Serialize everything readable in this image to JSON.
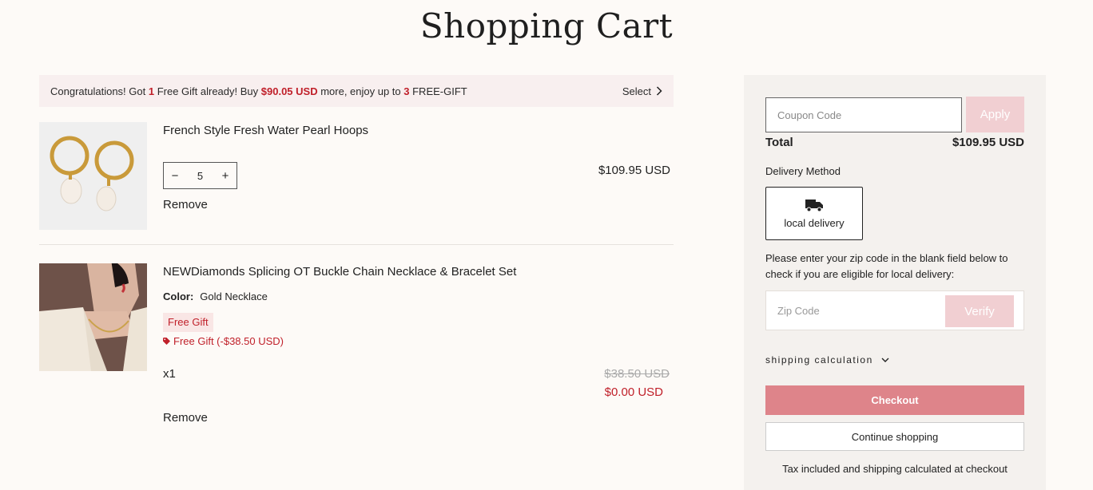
{
  "page": {
    "title": "Shopping Cart"
  },
  "banner": {
    "text1": "Congratulations! Got ",
    "gift_count": "1",
    "text2": " Free Gift already! Buy ",
    "amount": "$90.05 USD",
    "text3": " more, enjoy up to ",
    "max_gifts": "3",
    "text4": " FREE-GIFT",
    "select_label": "Select"
  },
  "items": [
    {
      "name": "French Style Fresh Water Pearl Hoops",
      "quantity": "5",
      "price": "$109.95 USD",
      "remove_label": "Remove"
    },
    {
      "name": "NEWDiamonds Splicing OT Buckle Chain Necklace & Bracelet Set",
      "option_label": "Color:",
      "option_value": "Gold Necklace",
      "badge": "Free Gift",
      "discount": "Free Gift (-$38.50 USD)",
      "quantity_text": "x1",
      "original_price": "$38.50 USD",
      "price": "$0.00 USD",
      "remove_label": "Remove"
    }
  ],
  "summary": {
    "coupon_placeholder": "Coupon Code",
    "apply_label": "Apply",
    "total_label": "Total",
    "total_value": "$109.95 USD",
    "delivery_label": "Delivery Method",
    "delivery_option": "local delivery",
    "zip_instructions": "Please enter your zip code in the blank field below to check if you are eligible for local delivery:",
    "zip_placeholder": "Zip Code",
    "verify_label": "Verify",
    "shipping_calc_label": "shipping calculation",
    "checkout_label": "Checkout",
    "continue_label": "Continue shopping",
    "tax_note": "Tax included and shipping calculated at checkout"
  },
  "colors": {
    "accent": "#de848a",
    "accent_light": "#f1cfd2",
    "sale_red": "#c0202a"
  }
}
